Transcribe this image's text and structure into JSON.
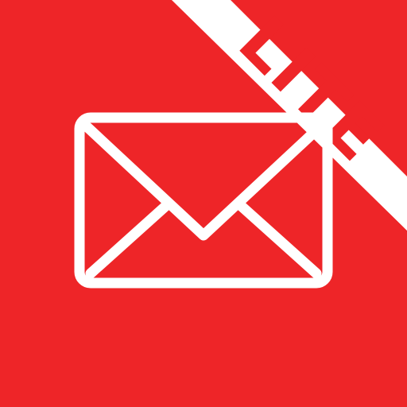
{
  "app_icon": {
    "badge_label": "LITE",
    "colors": {
      "background": "#ee2528",
      "ribbon": "#ffffff",
      "envelope_stroke": "#ffffff",
      "badge_text": "#ee2528"
    },
    "icon_name": "envelope-icon"
  }
}
